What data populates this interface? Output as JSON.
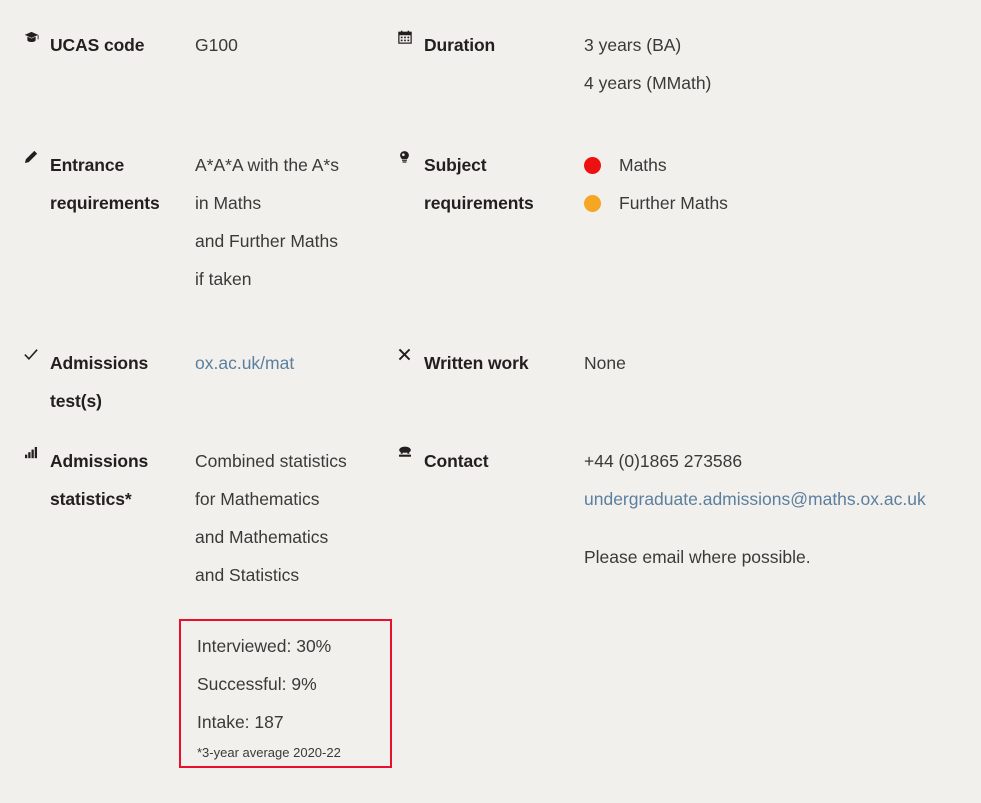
{
  "background_color": "#f2f0ec",
  "link_color": "#5b7f9e",
  "text_color": "#231f20",
  "rows": [
    {
      "left": {
        "icon": "graduation-cap-icon",
        "label": "UCAS code",
        "value_lines": [
          "G100"
        ]
      },
      "right": {
        "icon": "calendar-icon",
        "label": "Duration",
        "value_lines": [
          "3 years (BA)",
          "4 years (MMath)"
        ]
      }
    },
    {
      "left": {
        "icon": "pencil-icon",
        "label": "Entrance requirements",
        "label_line1": "Entrance",
        "label_line2": "requirements",
        "value_lines": [
          "A*A*A with the A*s",
          "in Maths",
          "and Further Maths",
          "if taken"
        ]
      },
      "right": {
        "icon": "lightbulb-icon",
        "label": "Subject requirements",
        "label_line1": "Subject",
        "label_line2": "requirements",
        "bullets": [
          {
            "color": "#ee1111",
            "label": "Maths"
          },
          {
            "color": "#f5a623",
            "label": "Further Maths"
          }
        ]
      }
    },
    {
      "left": {
        "icon": "check-icon",
        "label": "Admissions test(s)",
        "label_line1": "Admissions",
        "label_line2": "test(s)",
        "link_text": "ox.ac.uk/mat"
      },
      "right": {
        "icon": "cross-icon",
        "label": "Written work",
        "value_lines": [
          "None"
        ]
      }
    },
    {
      "left": {
        "icon": "bar-chart-icon",
        "label": "Admissions statistics*",
        "label_line1": "Admissions",
        "label_line2": "statistics*",
        "value_lines": [
          "Combined statistics",
          "for Mathematics",
          "and Mathematics",
          "and Statistics"
        ]
      },
      "right": {
        "icon": "telephone-icon",
        "label": "Contact",
        "phone": "+44 (0)1865 273586",
        "email": "undergraduate.admissions@maths.ox.ac.uk",
        "note": "Please email where possible."
      }
    }
  ],
  "stats_box": {
    "border_color": "#e8112d",
    "stats": [
      "Interviewed: 30%",
      "Successful: 9%",
      "Intake: 187"
    ],
    "footnote": "*3-year average 2020-22"
  }
}
